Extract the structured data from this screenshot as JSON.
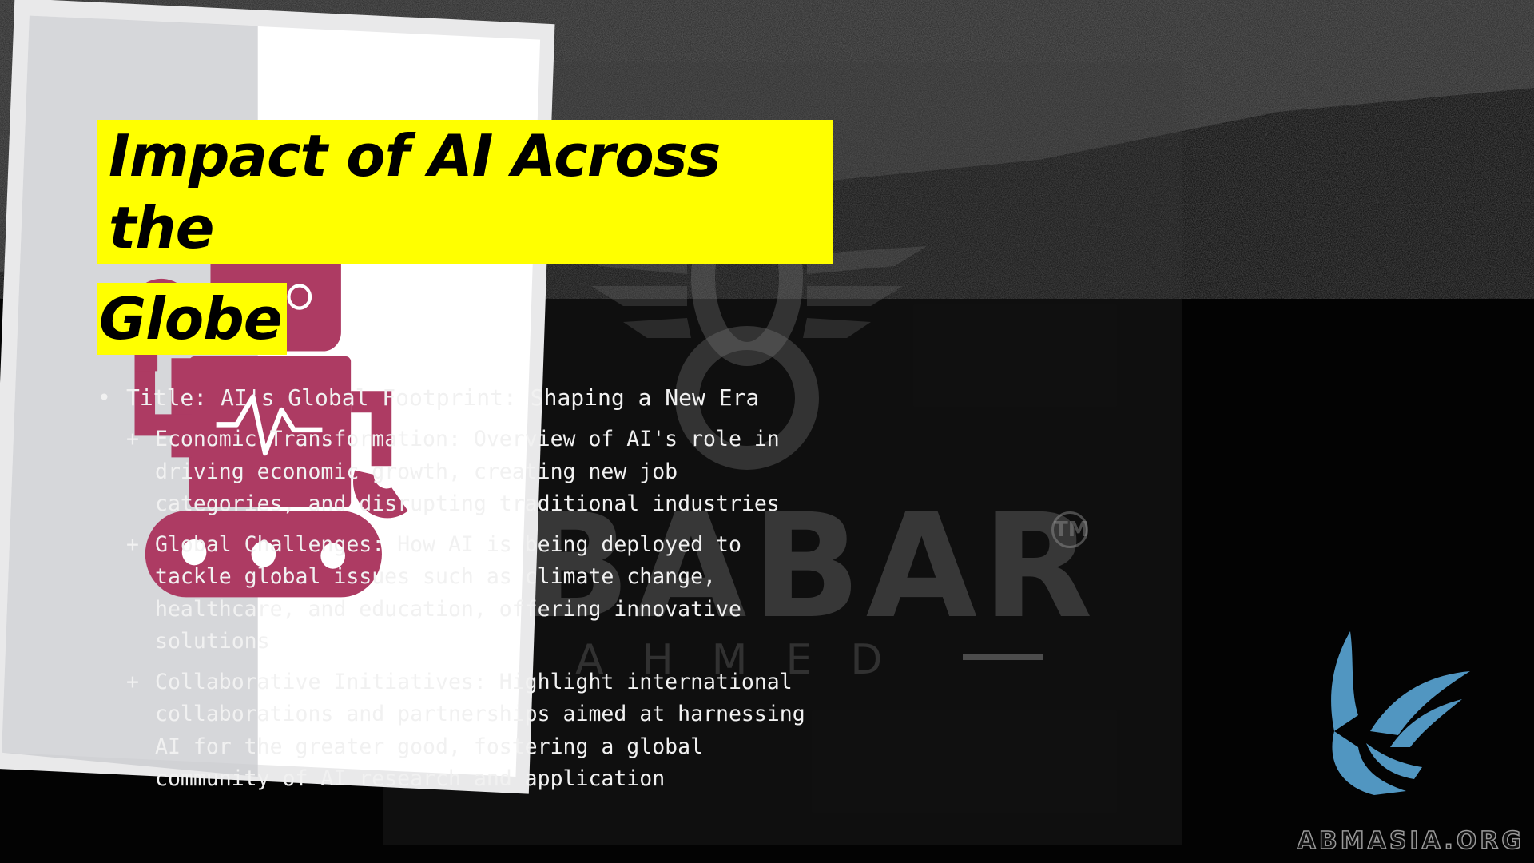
{
  "slide": {
    "title_line1": "Impact of AI Across the",
    "title_line2": "Globe",
    "main_bullet": {
      "marker": "•",
      "text": "Title: AI's Global Footprint: Shaping a New Era"
    },
    "sub_bullets": [
      {
        "marker": "+",
        "text": "Economic Transformation: Overview of AI's role in driving economic growth, creating new job categories, and disrupting traditional industries"
      },
      {
        "marker": "+",
        "text": "Global Challenges: How AI is being deployed to tackle global issues such as climate change, healthcare, and education, offering innovative solutions"
      },
      {
        "marker": "+",
        "text": "Collaborative Initiatives: Highlight international collaborations and partnerships aimed at harnessing AI for the greater good, fostering a global community of AI research and application"
      }
    ]
  },
  "watermark": {
    "name": "BABAR",
    "surname": "AHMED",
    "tm": "TM"
  },
  "site_logo": "ABMASIA.ORG",
  "colors": {
    "title_highlight": "#ffff00",
    "robot": "#ad3b63",
    "card": "#d9dadc",
    "bird": "#5aa6d6"
  },
  "icons": [
    "robot-icon",
    "bird-logo-icon",
    "winged-emblem-icon"
  ]
}
